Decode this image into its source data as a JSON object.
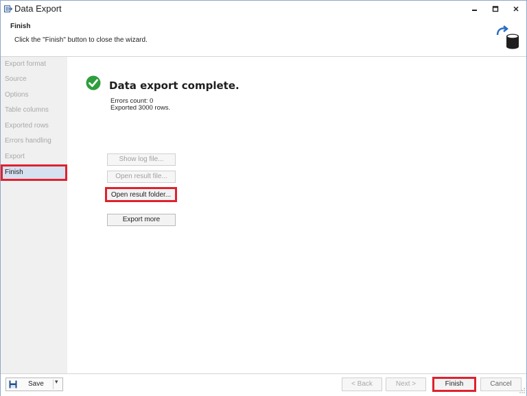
{
  "window": {
    "title": "Data Export",
    "controls": {
      "minimize": "▬",
      "maximize": "☐",
      "close": "✕"
    }
  },
  "header": {
    "title": "Finish",
    "description": "Click the \"Finish\" button to close the wizard.",
    "graphic_icon": "database-export-icon"
  },
  "sidebar": {
    "items": [
      {
        "label": "Export format",
        "active": false
      },
      {
        "label": "Source",
        "active": false
      },
      {
        "label": "Options",
        "active": false
      },
      {
        "label": "Table columns",
        "active": false
      },
      {
        "label": "Exported rows",
        "active": false
      },
      {
        "label": "Errors handling",
        "active": false
      },
      {
        "label": "Export",
        "active": false
      },
      {
        "label": "Finish",
        "active": true
      }
    ]
  },
  "main": {
    "status_icon": "check-circle-icon",
    "status_title": "Data export complete.",
    "errors_count": "Errors count: 0",
    "exported_rows": "Exported 3000 rows.",
    "buttons": {
      "show_log": "Show log file...",
      "open_result": "Open result file...",
      "open_folder": "Open result folder...",
      "export_more": "Export more"
    }
  },
  "footer": {
    "save_label": "Save",
    "back_label": "< Back",
    "next_label": "Next >",
    "finish_label": "Finish",
    "cancel_label": "Cancel"
  },
  "colors": {
    "accent_highlight": "#e0202d",
    "success": "#2e9e3e",
    "sidebar_bg": "#f0f0f0",
    "active_item_bg": "#d5e0f0"
  }
}
